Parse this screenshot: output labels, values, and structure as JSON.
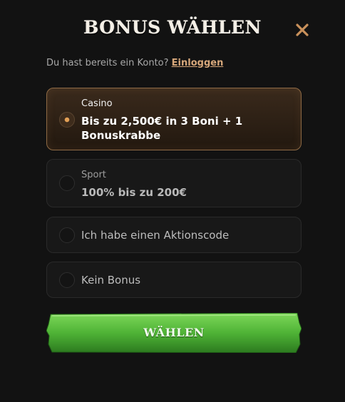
{
  "header": {
    "title": "BONUS WÄHLEN",
    "close_icon": "close-icon"
  },
  "login": {
    "prompt": "Du hast bereits ein Konto?",
    "link_label": "Einloggen"
  },
  "options": [
    {
      "category": "Casino",
      "label": "Bis zu 2,500€ in 3 Boni + 1 Bonuskrabbe",
      "selected": true
    },
    {
      "category": "Sport",
      "label": "100% bis zu 200€",
      "selected": false
    },
    {
      "category": "",
      "label": "Ich habe einen Aktionscode",
      "selected": false
    },
    {
      "category": "",
      "label": "Kein Bonus",
      "selected": false
    }
  ],
  "cta": {
    "label": "WÄHLEN"
  },
  "colors": {
    "background": "#121212",
    "accent": "#d7a87b",
    "selected_border": "#8e6a45",
    "cta_green": "#4fb336"
  }
}
